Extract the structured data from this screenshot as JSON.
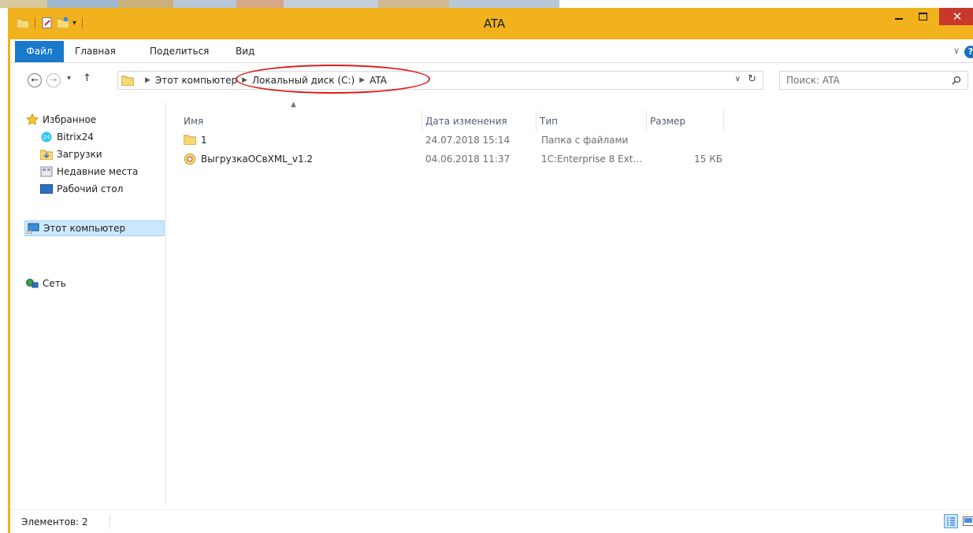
{
  "window": {
    "title": "ATA",
    "controls": {
      "minimize": "–",
      "close": "✕"
    }
  },
  "ribbon": {
    "tabs": [
      {
        "label": "Файл"
      },
      {
        "label": "Главная"
      },
      {
        "label": "Поделиться"
      },
      {
        "label": "Вид"
      }
    ],
    "help": "?"
  },
  "address": {
    "crumbs": [
      "Этот компьютер",
      "Локальный диск (C:)",
      "ATA"
    ],
    "highlight_color": "#e01a1a"
  },
  "search": {
    "placeholder": "Поиск: ATA"
  },
  "nav_pane": {
    "favorites": "Избранное",
    "items": [
      "Bitrix24",
      "Загрузки",
      "Недавние места",
      "Рабочий стол"
    ],
    "this_pc": "Этот компьютер",
    "network": "Сеть"
  },
  "columns": {
    "name": "Имя",
    "date": "Дата изменения",
    "type": "Тип",
    "size": "Размер"
  },
  "files": [
    {
      "name": "1",
      "date": "24.07.2018 15:14",
      "type": "Папка с файлами",
      "size": "",
      "icon": "folder-icon"
    },
    {
      "name": "ВыгрузкаОСвXML_v1.2",
      "date": "04.06.2018 11:37",
      "type": "1C:Enterprise 8 Ext...",
      "size": "15 КБ",
      "icon": "1c-file-icon"
    }
  ],
  "status": {
    "items_count": "Элементов: 2"
  },
  "colors": {
    "title_bar": "#f1b21e",
    "file_tab": "#1979ca",
    "close_button": "#c7392b",
    "selection": "#cce8ff"
  }
}
